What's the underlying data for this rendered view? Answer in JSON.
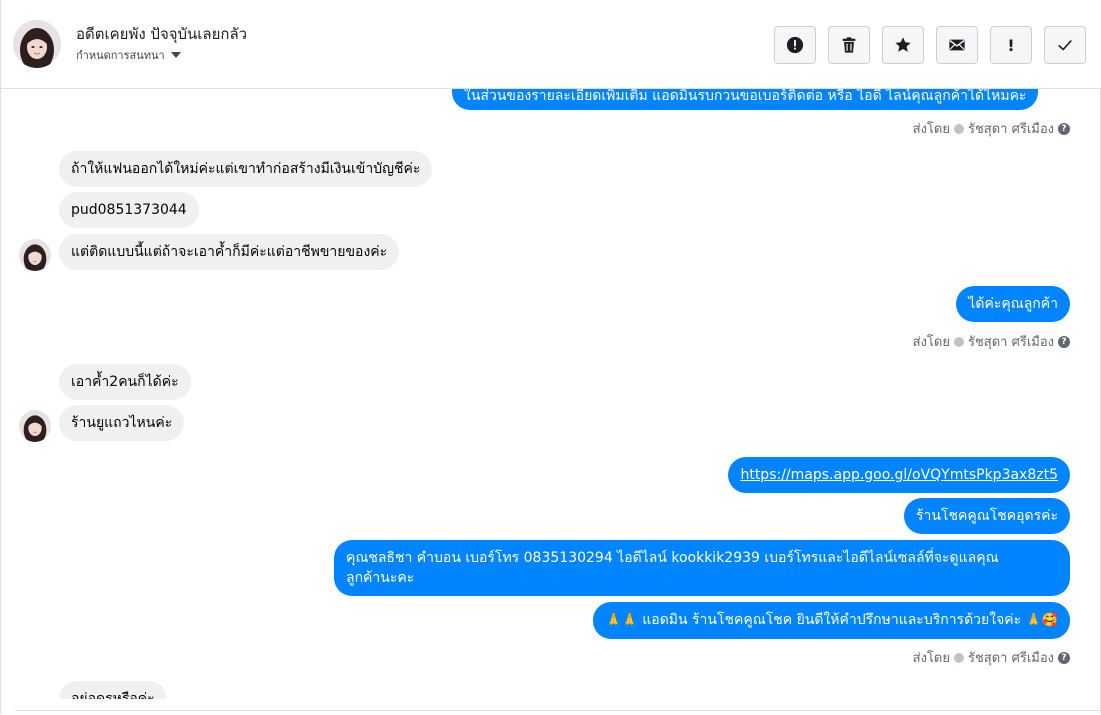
{
  "header": {
    "name": "อดีตเคยพัง ปัจจุบันเลยกลัว",
    "subtitle": "กำหนดการสนทนา"
  },
  "toolbar": {
    "buttons": [
      "alert-icon",
      "trash-icon",
      "star-icon",
      "envelope-icon",
      "exclamation-icon",
      "check-icon"
    ],
    "exclamation_label": "!"
  },
  "messages": {
    "m1": "ในส่วนของรายละเอียดเพิ่มเติม แอดมินรบกวนขอเบอร์ติดต่อ หรือ ไอดี ไลน์คุณลูกค้าได้ไหมคะ",
    "m2": "ถ้าให้แฟนออกได้ใหม่ค่ะแต่เขาทำก่อสร้างมีเงินเข้าบัญชีค่ะ",
    "m3": "pud0851373044",
    "m4": "แต่ติดแบบนี้แต่ถ้าจะเอาค้ำก็มีค่ะแต่อาชีพขายของค่ะ",
    "m5": "ได้ค่ะคุณลูกค้า",
    "m6": "เอาค้ำ2คนก็ได้ค่ะ",
    "m7": "ร้านยูแถวไหนค่ะ",
    "m8": "https://maps.app.goo.gl/oVQYmtsPkp3ax8zt5",
    "m9": "ร้านโชคคูณโชคอุดรค่ะ",
    "m10_line1": "คุณชลธิชา คำบอน เบอร์โทร 0835130294  ไอดีไลน์ kookkik2939   เบอร์โทรและไอดีไลน์เซลล์ที่จะดูแลคุณ",
    "m10_line2": "ลูกค้านะคะ",
    "m11": "แอดมิน ร้านโชคคูณโชค ยินดีให้คำปรึกษาและบริการด้วยใจค่ะ",
    "m12": "อยู่อุดรหรือค่ะ"
  },
  "sent_by": {
    "label": "ส่งโดย",
    "agent": "รัชสุดา ศรีเมือง",
    "help": "?"
  }
}
